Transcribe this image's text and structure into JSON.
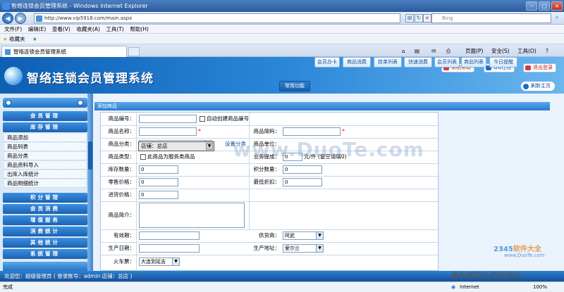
{
  "window": {
    "title": "智络连锁会员管理系统 - Windows Internet Explorer"
  },
  "addressbar": {
    "url": "http://www.vip5918.com/main.aspx",
    "search_placeholder": "Bing"
  },
  "menubar": [
    "文件(F)",
    "编辑(E)",
    "查看(V)",
    "收藏夹(A)",
    "工具(T)",
    "帮助(H)"
  ],
  "favbar": {
    "label": "收藏夹"
  },
  "tab": {
    "title": "智络连锁会员管理系统"
  },
  "commandbar": {
    "page": "页面(P)",
    "safety": "安全(S)",
    "tools": "工具(O)"
  },
  "app": {
    "title": "智络连锁会员管理系统",
    "header_buttons": [
      "系统帮助",
      "QQ在线",
      "退出登录"
    ],
    "sysfunc": "常用功能",
    "nav": [
      "会员办卡",
      "商品消费",
      "挂单列表",
      "快速消费",
      "会员列表",
      "商品列表",
      "今日提醒"
    ],
    "logout": "刷新主页"
  },
  "sidebar": {
    "sections": [
      "会员管理",
      "库存管理",
      "积分管理",
      "会员消费",
      "增值服务",
      "消费统计",
      "其他统计",
      "系统管理"
    ],
    "stock_items": [
      "商品添加",
      "商品列表",
      "商品分类",
      "商品资料导入",
      "出库入库统计",
      "商品明细统计"
    ]
  },
  "form": {
    "header": "添加商品",
    "labels": {
      "code": "商品编号：",
      "auto": "自动创建商品编号",
      "name": "商品名称：",
      "abbr": "商品简码：",
      "category": "商品分类：",
      "set_category": "设置分类",
      "unit": "商品单位：",
      "type": "商品类型：",
      "service": "此商品为服务类商品",
      "commission": "业务提成：",
      "commission_unit": "元/件 (留空请填0)",
      "stock": "库存数量：",
      "points": "积分数量：",
      "retail": "零售价格：",
      "min_discount": "最低折扣：",
      "purchase": "进货价格：",
      "intro": "商品简介：",
      "expiry": "有效期：",
      "supplier": "供货商：",
      "produced": "生产日期：",
      "origin": "生产地址：",
      "train": "火车票："
    },
    "values": {
      "commission": "0",
      "stock": "0",
      "points": "0",
      "retail": "0",
      "min_discount": "0",
      "purchase": "0",
      "supplier": "阿武",
      "origin": "爱尔兰",
      "train": "大连到延吉",
      "category": "店铺：总店"
    }
  },
  "footer": {
    "text": "欢迎您：超级管理员 ( 登录账号：admin 店铺：总店 )"
  },
  "statusbar": {
    "left": "完成",
    "zone": "Internet",
    "zoom": "100%"
  },
  "watermarks": {
    "duote": "www.DuoTe.com",
    "bottom": "最权威安全的软件站",
    "logo": "2345软件大全",
    "url": "www.DuoTe.com"
  }
}
